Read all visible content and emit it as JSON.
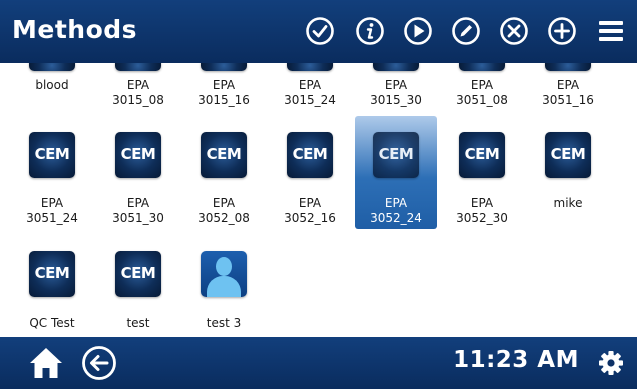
{
  "header": {
    "title": "Methods"
  },
  "toolbar": {
    "check_icon": "check-circle-icon",
    "info_icon": "info-circle-icon",
    "play_icon": "play-circle-icon",
    "edit_icon": "pencil-circle-icon",
    "delete_icon": "x-circle-icon",
    "add_icon": "plus-circle-icon",
    "menu_icon": "hamburger-menu-icon"
  },
  "methods": {
    "row1": [
      {
        "label": "blood"
      },
      {
        "label": "EPA\n3015_08"
      },
      {
        "label": "EPA\n3015_16"
      },
      {
        "label": "EPA\n3015_24"
      },
      {
        "label": "EPA\n3015_30"
      },
      {
        "label": "EPA\n3051_08"
      },
      {
        "label": "EPA\n3051_16"
      }
    ],
    "row2": [
      {
        "label": "EPA\n3051_24",
        "badge": "CEM"
      },
      {
        "label": "EPA\n3051_30",
        "badge": "CEM"
      },
      {
        "label": "EPA\n3052_08",
        "badge": "CEM"
      },
      {
        "label": "EPA\n3052_16",
        "badge": "CEM"
      },
      {
        "label": "EPA\n3052_24",
        "badge": "CEM",
        "selected": true
      },
      {
        "label": "EPA\n3052_30",
        "badge": "CEM"
      },
      {
        "label": "mike",
        "badge": "CEM"
      }
    ],
    "row3": [
      {
        "label": "QC Test",
        "badge": "CEM"
      },
      {
        "label": "test",
        "badge": "CEM"
      },
      {
        "label": "test 3",
        "icon": "user-avatar-icon"
      }
    ]
  },
  "footer": {
    "home_icon": "home-icon",
    "back_icon": "back-arrow-circle-icon",
    "time": "11:23 AM",
    "settings_icon": "gear-icon"
  },
  "colors": {
    "bar": "#0d3166",
    "selected": "#2d6fb6",
    "badge": "#0e2d58"
  }
}
